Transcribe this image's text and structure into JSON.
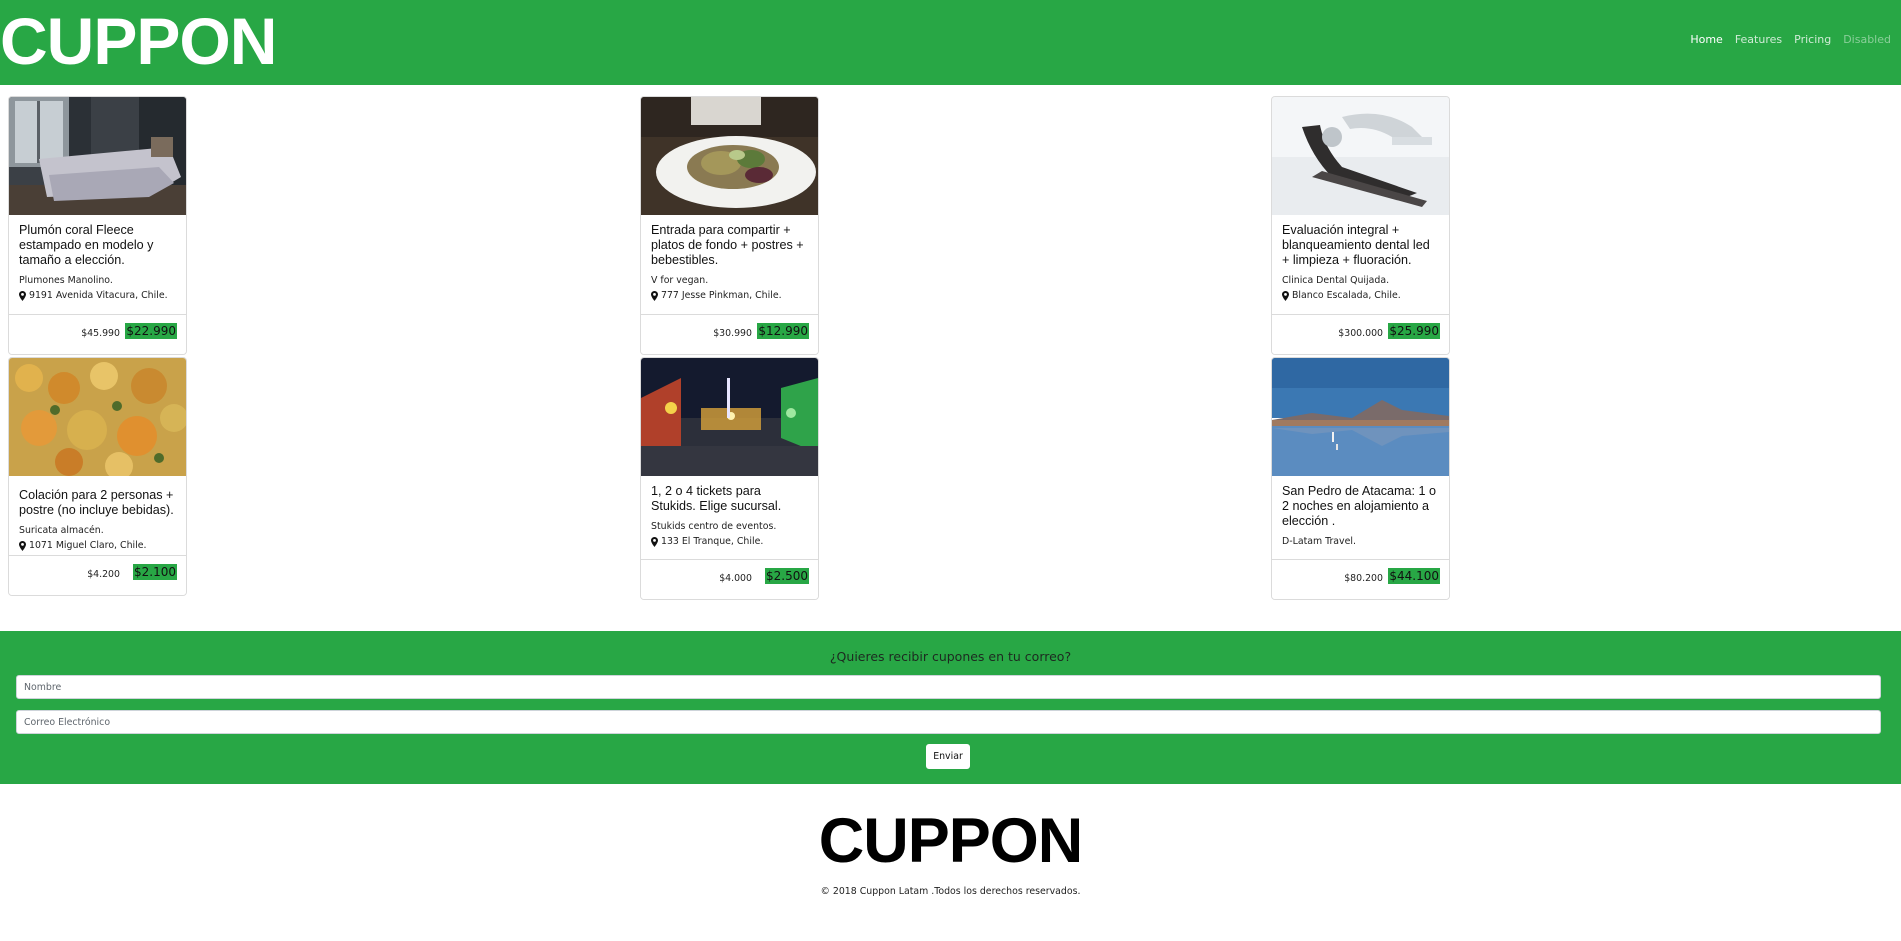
{
  "navbar": {
    "brand": "CUPPON",
    "links": [
      {
        "label": "Home",
        "state": "active"
      },
      {
        "label": "Features",
        "state": "normal"
      },
      {
        "label": "Pricing",
        "state": "normal"
      },
      {
        "label": "Disabled",
        "state": "disabled"
      }
    ]
  },
  "colors": {
    "brand_green": "#28a745",
    "white": "#ffffff",
    "text_dark": "#212529"
  },
  "cards": [
    {
      "image": "bedroom-photo",
      "title": "Plumón coral Fleece estampado en modelo y tamaño a elección.",
      "store": "Plumones Manolino.",
      "address": "9191 Avenida Vitacura, Chile.",
      "old_price": "$45.990",
      "new_price": "$22.990"
    },
    {
      "image": "salad-plate-photo",
      "title": "Entrada para compartir + platos de fondo + postres + bebestibles.",
      "store": "V for vegan.",
      "address": "777 Jesse Pinkman, Chile.",
      "old_price": "$30.990",
      "new_price": "$12.990"
    },
    {
      "image": "dental-chair-photo",
      "title": "Evaluación integral + blanqueamiento dental led + limpieza + fluoración.",
      "store": "Clinica Dental Quijada.",
      "address": "Blanco Escalada, Chile.",
      "old_price": "$300.000",
      "new_price": "$25.990"
    },
    {
      "image": "food-stew-photo",
      "title": "Colación para 2 personas + postre (no incluye bebidas).",
      "store": "Suricata almacén.",
      "address": "1071 Miguel Claro, Chile.",
      "old_price": "$4.200",
      "new_price": "$2.100"
    },
    {
      "image": "carnival-lights-photo",
      "title": "1, 2 o 4 tickets para Stukids. Elige sucursal.",
      "store": "Stukids centro de eventos.",
      "address": "133 El Tranque, Chile.",
      "old_price": "$4.000",
      "new_price": "$2.500"
    },
    {
      "image": "salt-lake-landscape-photo",
      "title": "San Pedro de Atacama: 1 o 2 noches en alojamiento a elección .",
      "store": "D-Latam Travel.",
      "address": "",
      "old_price": "$80.200",
      "new_price": "$44.100"
    }
  ],
  "subscribe": {
    "title": "¿Quieres recibir cupones en tu correo?",
    "name_placeholder": "Nombre",
    "name_value": "",
    "email_placeholder": "Correo Electrónico",
    "email_value": "",
    "button_label": "Enviar"
  },
  "footer": {
    "logo": "CUPPON",
    "copyright": "© 2018 Cuppon Latam .Todos los derechos reservados."
  },
  "icons": {
    "address": "map-pin-icon"
  }
}
